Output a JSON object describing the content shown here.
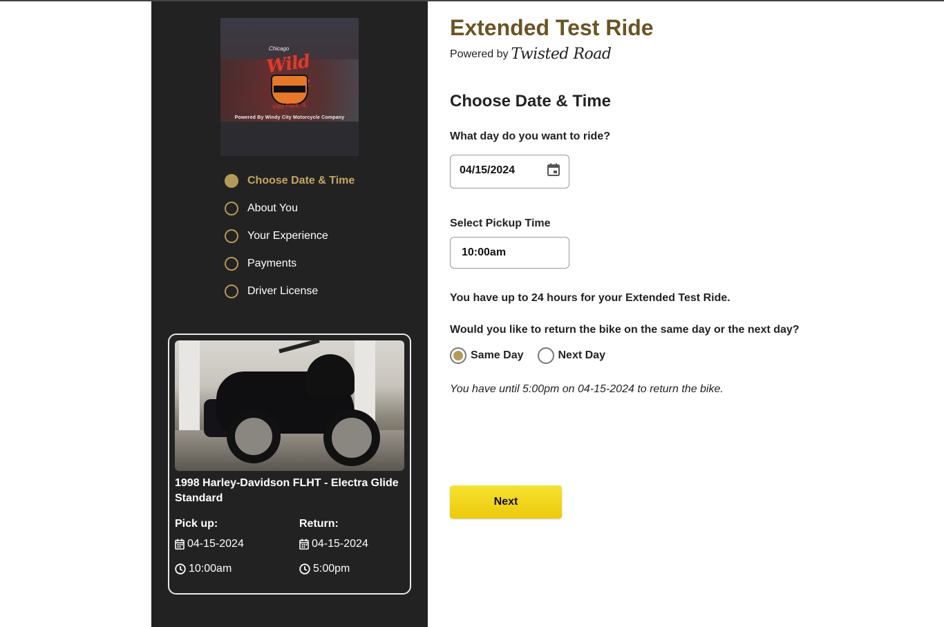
{
  "dealer_logo": {
    "top_text": "Chicago",
    "name": "Wild Fire",
    "location": "Villa Park, IL",
    "powered_text": "Powered By Windy City Motorcycle Company"
  },
  "steps": [
    {
      "label": "Choose Date & Time",
      "active": true
    },
    {
      "label": "About You",
      "active": false
    },
    {
      "label": "Your Experience",
      "active": false
    },
    {
      "label": "Payments",
      "active": false
    },
    {
      "label": "Driver License",
      "active": false
    }
  ],
  "bike_card": {
    "title": "1998 Harley-Davidson FLHT - Electra Glide Standard",
    "pickup": {
      "heading": "Pick up:",
      "date": "04-15-2024",
      "time": "10:00am"
    },
    "return": {
      "heading": "Return:",
      "date": "04-15-2024",
      "time": "5:00pm"
    }
  },
  "header": {
    "title": "Extended Test Ride",
    "powered_by": "Powered by",
    "brand": "Twisted Road"
  },
  "form": {
    "section_title": "Choose Date & Time",
    "date_question": "What day do you want to ride?",
    "date_value": "04/15/2024",
    "time_question": "Select Pickup Time",
    "time_value": "10:00am",
    "info_text": "You have up to 24 hours for your Extended Test Ride.",
    "return_question": "Would you like to return the bike on the same day or the next day?",
    "return_options": [
      {
        "label": "Same Day",
        "checked": true
      },
      {
        "label": "Next Day",
        "checked": false
      }
    ],
    "return_note": "You have until 5:00pm on 04-15-2024 to return the bike.",
    "next_label": "Next"
  },
  "colors": {
    "accent_gold": "#b49a5a",
    "title_brown": "#6a5423",
    "sidebar_bg": "#222222",
    "button_yellow": "#f2d51c"
  }
}
